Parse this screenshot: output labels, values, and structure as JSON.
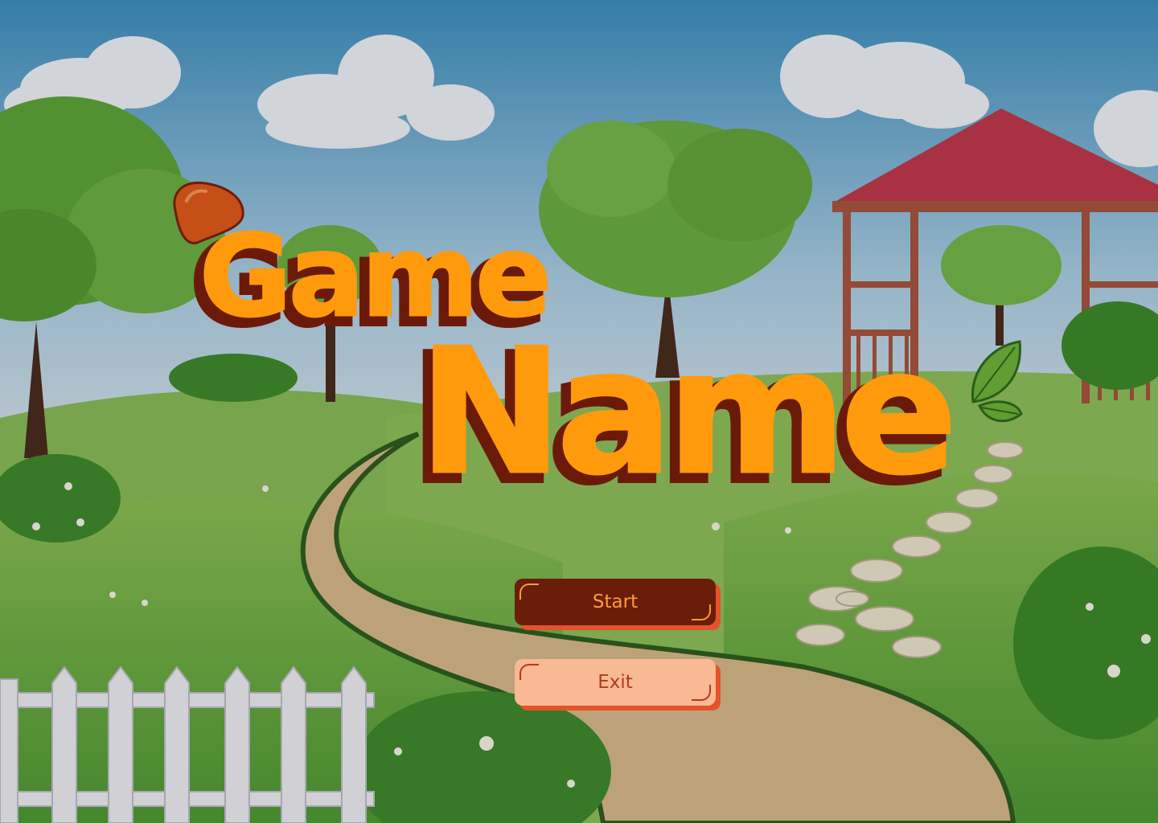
{
  "title": {
    "line1": "Game",
    "line2": "Name"
  },
  "menu": {
    "start_label": "Start",
    "exit_label": "Exit"
  },
  "colors": {
    "title_fill": "#ff9a0d",
    "title_shadow": "#6b1a0a",
    "start_bg": "#6a1d08",
    "start_text": "#ff9a3a",
    "exit_bg": "#f8b993",
    "exit_text": "#b33a1a",
    "button_shadow": "#e4532a"
  },
  "icons": [
    "acorn-cap-icon",
    "leaf-icon"
  ]
}
